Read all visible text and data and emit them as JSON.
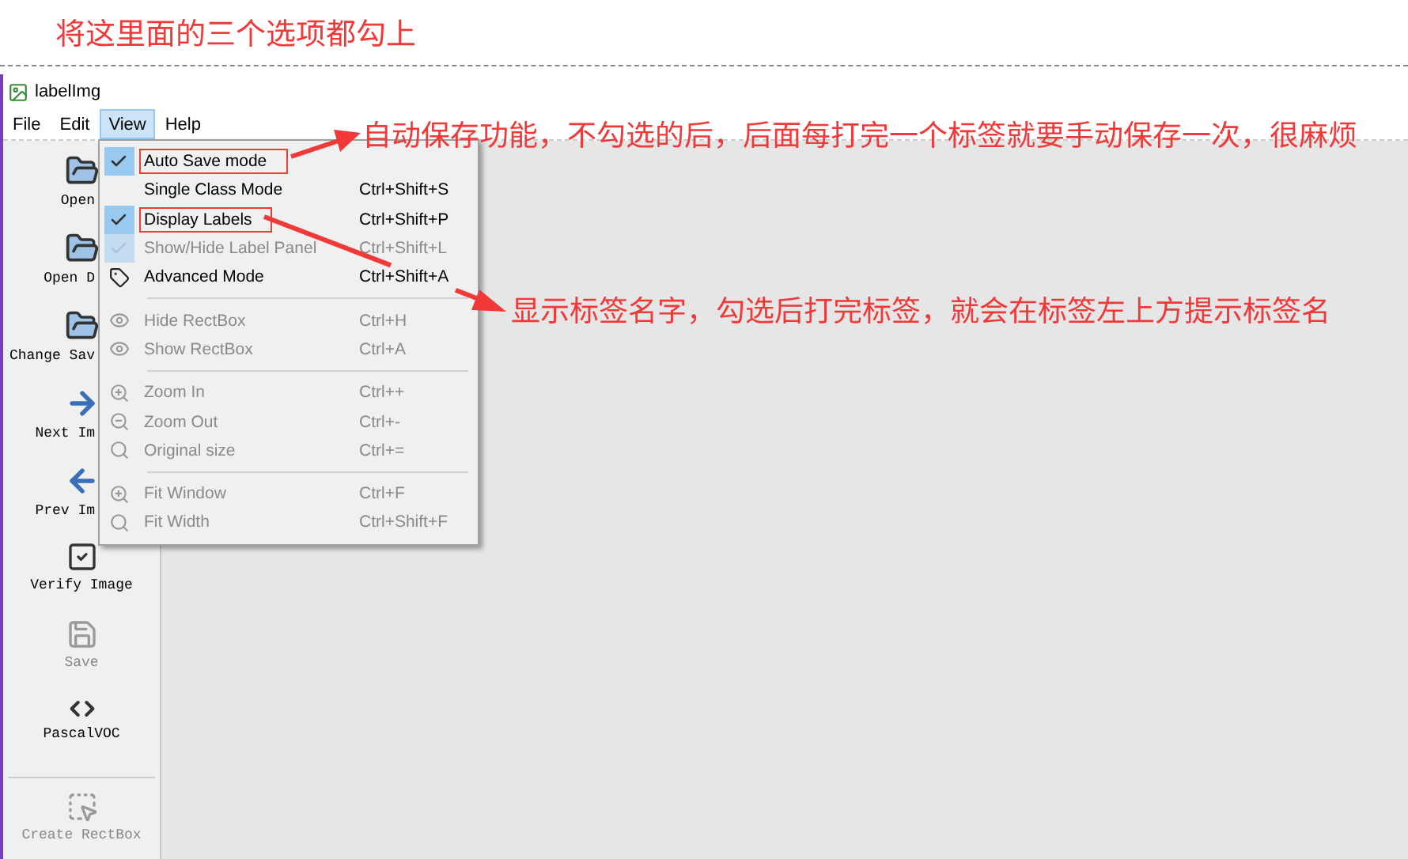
{
  "caption": "将这里面的三个选项都勾上",
  "window": {
    "title": "labelImg"
  },
  "menubar": [
    {
      "label": "File",
      "selected": false
    },
    {
      "label": "Edit",
      "selected": false
    },
    {
      "label": "View",
      "selected": true
    },
    {
      "label": "Help",
      "selected": false
    }
  ],
  "toolbar": [
    {
      "kind": "button",
      "label": "Open",
      "disabled": false
    },
    {
      "kind": "button",
      "label": "Open D",
      "disabled": false
    },
    {
      "kind": "button",
      "label": "Change Sav",
      "disabled": false
    },
    {
      "kind": "button",
      "label": "Next Im",
      "disabled": false
    },
    {
      "kind": "button",
      "label": "Prev Im",
      "disabled": false
    },
    {
      "kind": "button",
      "label": "Verify Image",
      "disabled": false
    },
    {
      "kind": "button",
      "label": "Save",
      "disabled": true
    },
    {
      "kind": "button",
      "label": "PascalVOC",
      "disabled": false
    },
    {
      "kind": "separator"
    },
    {
      "kind": "button",
      "label": "Create RectBox",
      "disabled": true
    }
  ],
  "view_menu": [
    {
      "kind": "check",
      "label": "Auto Save mode",
      "checked": true,
      "disabled": false,
      "highlighted": true
    },
    {
      "kind": "check",
      "label": "Single Class Mode",
      "shortcut": "Ctrl+Shift+S",
      "checked": false,
      "disabled": false,
      "highlighted": false
    },
    {
      "kind": "check",
      "label": "Display Labels",
      "shortcut": "Ctrl+Shift+P",
      "checked": true,
      "disabled": false,
      "highlighted": true
    },
    {
      "kind": "check",
      "label": "Show/Hide Label Panel",
      "shortcut": "Ctrl+Shift+L",
      "checked": true,
      "disabled": true,
      "highlighted": false
    },
    {
      "kind": "action",
      "label": "Advanced Mode",
      "shortcut": "Ctrl+Shift+A",
      "disabled": false
    },
    {
      "kind": "separator"
    },
    {
      "kind": "action",
      "label": "Hide RectBox",
      "shortcut": "Ctrl+H",
      "disabled": true
    },
    {
      "kind": "action",
      "label": "Show RectBox",
      "shortcut": "Ctrl+A",
      "disabled": true
    },
    {
      "kind": "separator"
    },
    {
      "kind": "action",
      "label": "Zoom In",
      "shortcut": "Ctrl++",
      "disabled": true
    },
    {
      "kind": "action",
      "label": "Zoom Out",
      "shortcut": "Ctrl+-",
      "disabled": true
    },
    {
      "kind": "action",
      "label": "Original size",
      "shortcut": "Ctrl+=",
      "disabled": true
    },
    {
      "kind": "separator"
    },
    {
      "kind": "action",
      "label": "Fit Window",
      "shortcut": "Ctrl+F",
      "disabled": true
    },
    {
      "kind": "action",
      "label": "Fit Width",
      "shortcut": "Ctrl+Shift+F",
      "disabled": true
    }
  ],
  "annotations": [
    {
      "text": "自动保存功能，不勾选的后，后面每打完一个标签就要手动保存一次，很麻烦"
    },
    {
      "text": "显示标签名字，勾选后打完标签，就会在标签左上方提示标签名"
    }
  ]
}
